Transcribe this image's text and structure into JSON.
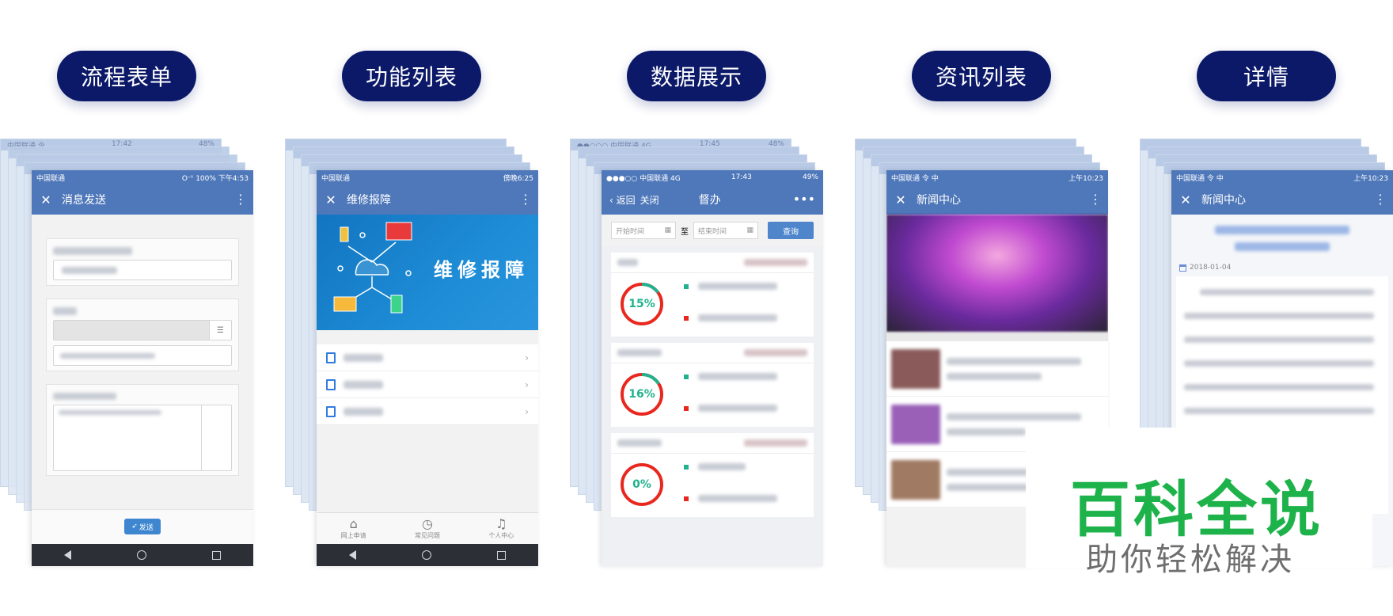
{
  "categories": [
    {
      "pill": "流程表单"
    },
    {
      "pill": "功能列表"
    },
    {
      "pill": "数据展示"
    },
    {
      "pill": "资讯列表"
    },
    {
      "pill": "详情"
    }
  ],
  "ghost_status": {
    "carrier": "●●○○○ 中国联通 4G",
    "time": "17:45",
    "battery": "48%"
  },
  "ghost_status_alt": {
    "carrier": "中国联通 令",
    "time": "17:42",
    "battery": "48%"
  },
  "form_screen": {
    "carrier": "中国联通",
    "status_right": "O⁻ᵗ 100% 下午4:53",
    "title": "消息发送",
    "send_label": "发送"
  },
  "list_screen": {
    "carrier": "中国联通",
    "status_right": "傍晚6:25",
    "title": "维修报障",
    "banner_text": "维修报障",
    "tabs": [
      {
        "label": "网上申请",
        "icon": "house-icon"
      },
      {
        "label": "常见问题",
        "icon": "clock-icon"
      },
      {
        "label": "个人中心",
        "icon": "bell-icon"
      }
    ]
  },
  "data_screen": {
    "carrier": "●●●○○ 中国联通 4G",
    "time": "17:43",
    "battery": "49%",
    "back": "返回",
    "close": "关闭",
    "title": "督办",
    "more": "•••",
    "start_ph": "开始时间",
    "to": "至",
    "end_ph": "结束时间",
    "query": "查询",
    "rings": [
      {
        "label": "15%",
        "value": 0.15
      },
      {
        "label": "16%",
        "value": 0.16
      },
      {
        "label": "0%",
        "value": 0
      }
    ],
    "colors": {
      "accent": "#21b28d",
      "danger": "#e8281e"
    }
  },
  "news_screen": {
    "carrier": "中国联通 令 中",
    "status_right": "上午10:23",
    "title": "新闻中心"
  },
  "detail_screen": {
    "carrier": "中国联通 令 中",
    "status_right": "上午10:23",
    "title": "新闻中心",
    "date": "2018-01-04"
  },
  "watermark": {
    "line1": "百科全说",
    "line2": "助你轻松解决"
  }
}
